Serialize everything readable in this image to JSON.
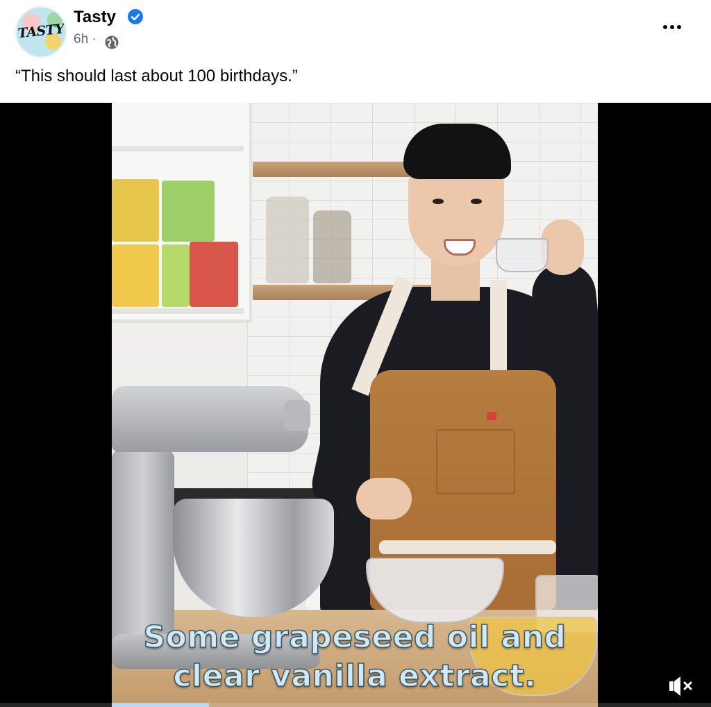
{
  "post": {
    "page_name": "Tasty",
    "avatar_text": "TASTY",
    "timestamp": "6h",
    "separator": "·",
    "caption": "“This should last about 100 birthdays.”"
  },
  "video": {
    "subtitle_line1": "Some grapeseed oil and",
    "subtitle_line2": "clear vanilla extract.",
    "progress_fraction": 0.2,
    "muted": true
  },
  "icons": {
    "verified": "verified-badge-icon",
    "audience": "globe-icon",
    "menu": "more-options-icon",
    "sound": "speaker-muted-icon"
  },
  "colors": {
    "verified_blue": "#1877f2",
    "meta_gray": "#65676b",
    "subtitle_fill": "#cfe9f7"
  }
}
